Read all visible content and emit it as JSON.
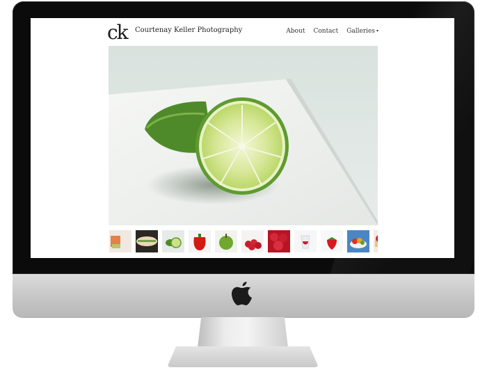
{
  "site": {
    "logo_text": "ck",
    "title": "Courtenay Keller Photography"
  },
  "nav": {
    "items": [
      {
        "label": "About"
      },
      {
        "label": "Contact"
      },
      {
        "label": "Galleries"
      }
    ],
    "galleries_caret": "▾"
  },
  "hero": {
    "subject": "halved lime on white plate"
  },
  "thumbnails": [
    {
      "subject": "food dish"
    },
    {
      "subject": "sandwich"
    },
    {
      "subject": "lime"
    },
    {
      "subject": "red pepper"
    },
    {
      "subject": "green apple"
    },
    {
      "subject": "raspberries"
    },
    {
      "subject": "raspberry pile"
    },
    {
      "subject": "strawberry in glass"
    },
    {
      "subject": "strawberry"
    },
    {
      "subject": "fruit bowl"
    },
    {
      "subject": "strawberry tart"
    }
  ],
  "device": {
    "brand_icon": "apple-icon"
  }
}
